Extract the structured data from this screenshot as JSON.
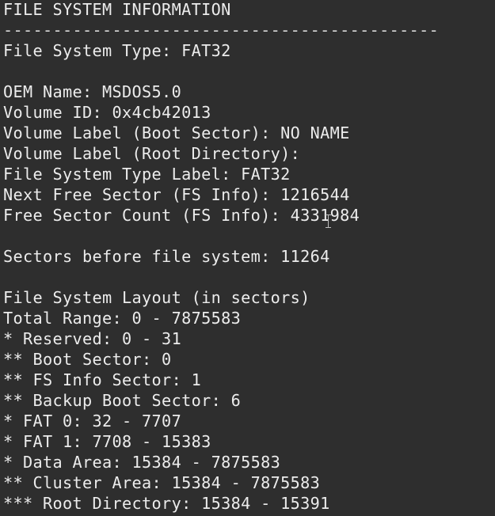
{
  "terminal": {
    "lines": [
      "FILE SYSTEM INFORMATION",
      "--------------------------------------------",
      "File System Type: FAT32",
      "",
      "OEM Name: MSDOS5.0",
      "Volume ID: 0x4cb42013",
      "Volume Label (Boot Sector): NO NAME",
      "Volume Label (Root Directory):",
      "File System Type Label: FAT32",
      "Next Free Sector (FS Info): 1216544",
      "Free Sector Count (FS Info): 4331984",
      "",
      "Sectors before file system: 11264",
      "",
      "File System Layout (in sectors)",
      "Total Range: 0 - 7875583",
      "* Reserved: 0 - 31",
      "** Boot Sector: 0",
      "** FS Info Sector: 1",
      "** Backup Boot Sector: 6",
      "* FAT 0: 32 - 7707",
      "* FAT 1: 7708 - 15383",
      "* Data Area: 15384 - 7875583",
      "** Cluster Area: 15384 - 7875583",
      "*** Root Directory: 15384 - 15391"
    ]
  }
}
